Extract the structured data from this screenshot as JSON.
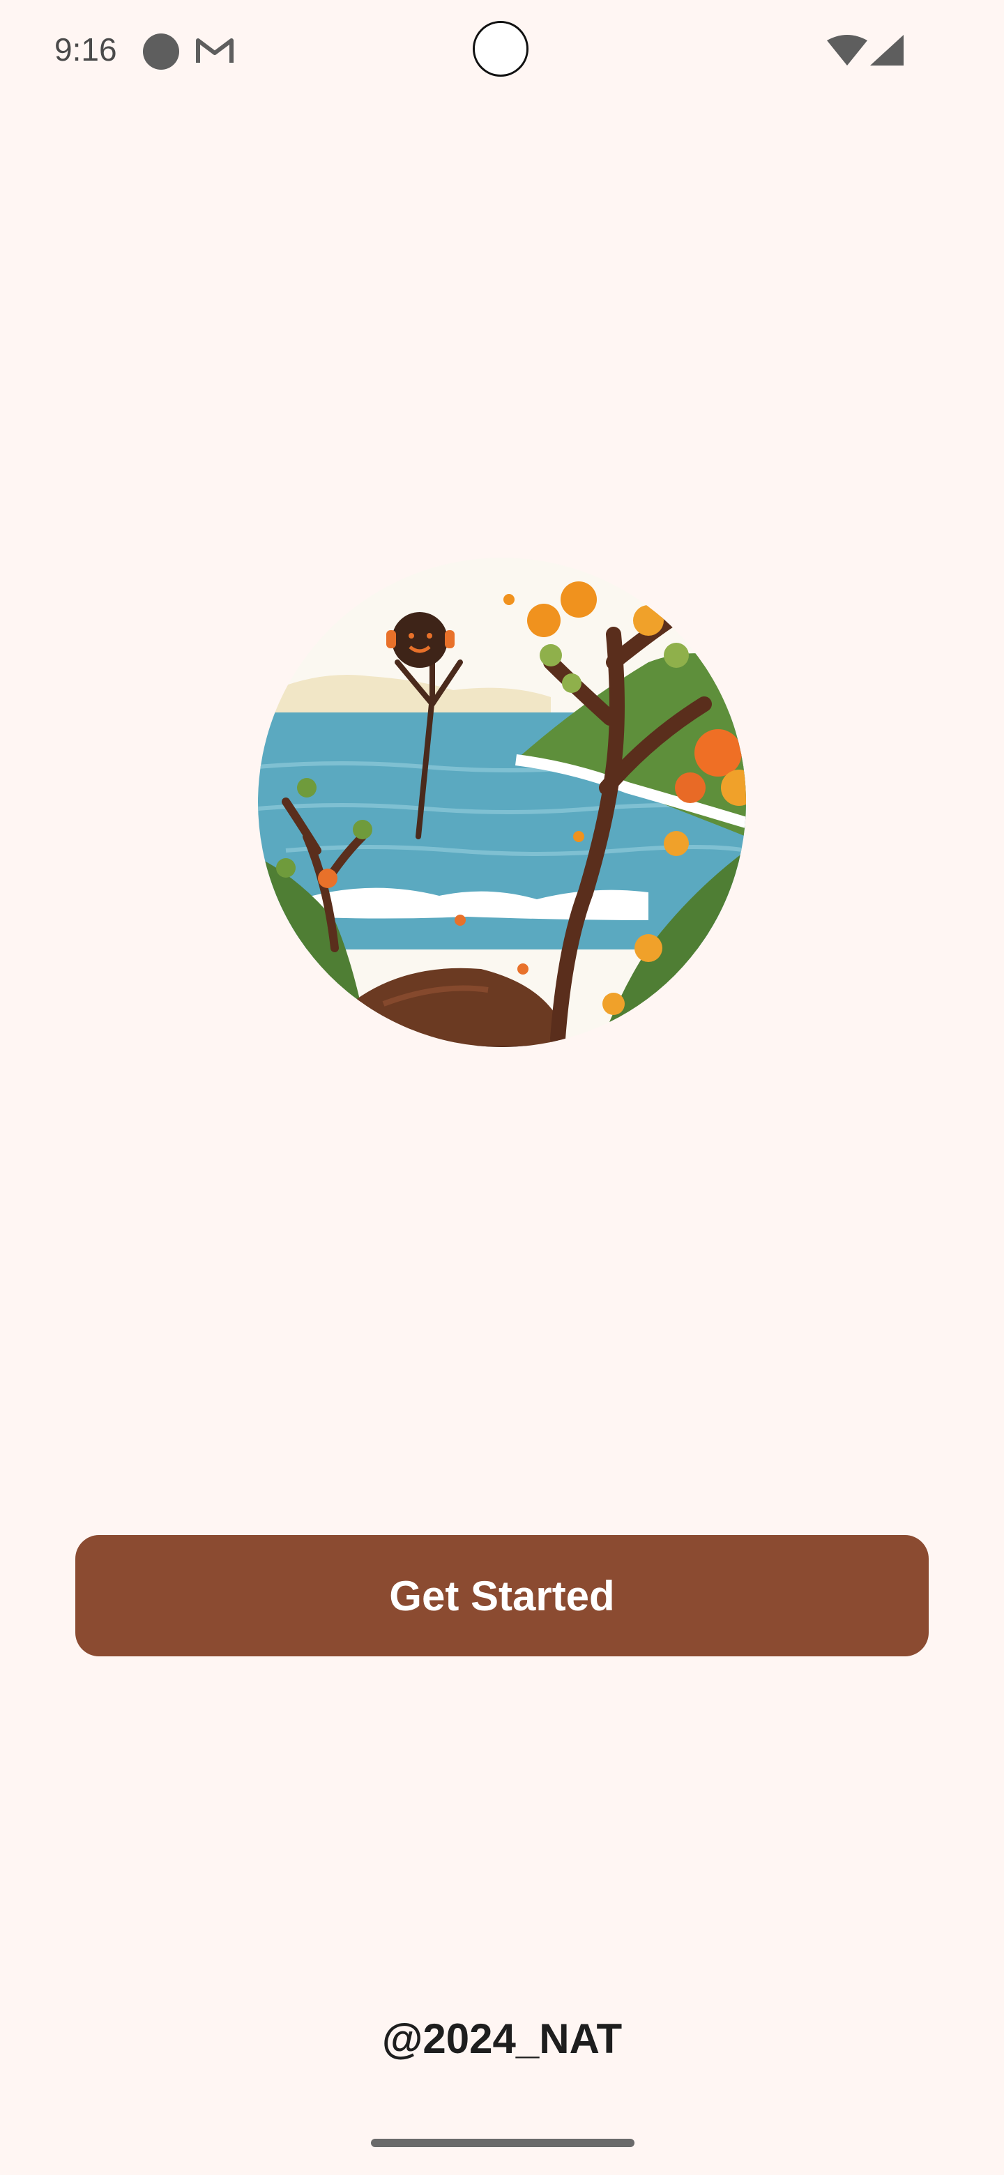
{
  "status_bar": {
    "time": "9:16",
    "icons": [
      "notification-dot-icon",
      "gmail-icon",
      "camera-cutout",
      "wifi-icon",
      "cell-signal-icon"
    ]
  },
  "illustration": {
    "name": "stick-figure-seaside-illustration"
  },
  "actions": {
    "get_started_label": "Get Started"
  },
  "footer": {
    "text": "@2024_NAT"
  },
  "colors": {
    "background": "#FFF6F3",
    "button": "#8B4B31",
    "button_text": "#FFFFFF",
    "footer_text": "#1E1E1E"
  }
}
